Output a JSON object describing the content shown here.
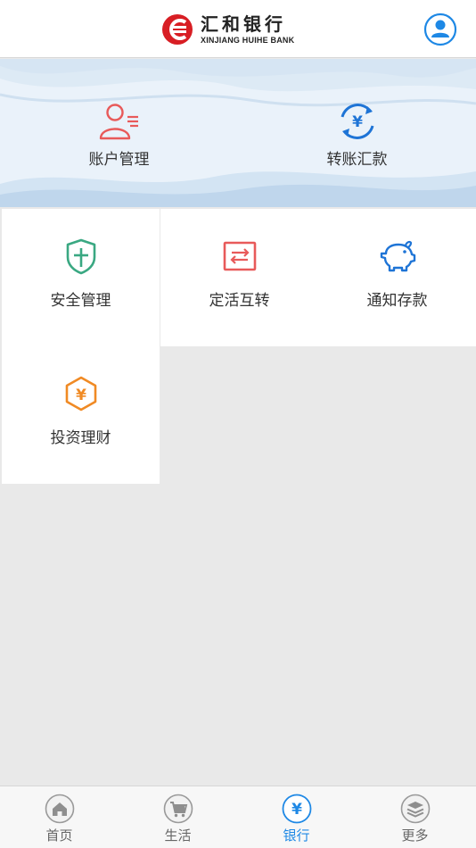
{
  "header": {
    "logo_cn": "汇和银行",
    "logo_en": "XINJIANG HUIHE BANK",
    "logo_icon": "bank-logo-icon",
    "user_icon": "user-avatar-icon"
  },
  "banner": {
    "items": [
      {
        "label": "账户管理",
        "icon": "account-user-icon",
        "color": "#e85a5a"
      },
      {
        "label": "转账汇款",
        "icon": "transfer-yuan-icon",
        "color": "#1e74d6"
      }
    ]
  },
  "grid": {
    "items": [
      {
        "label": "安全管理",
        "icon": "shield-icon",
        "color": "#3aa882"
      },
      {
        "label": "定活互转",
        "icon": "swap-arrows-icon",
        "color": "#e85a5a"
      },
      {
        "label": "通知存款",
        "icon": "piggy-bank-icon",
        "color": "#1e74d6"
      },
      {
        "label": "投资理财",
        "icon": "hexagon-yuan-icon",
        "color": "#f08a24"
      }
    ]
  },
  "tabbar": {
    "items": [
      {
        "label": "首页",
        "icon": "home-icon",
        "active": false
      },
      {
        "label": "生活",
        "icon": "cart-icon",
        "active": false
      },
      {
        "label": "银行",
        "icon": "yuan-icon",
        "active": true
      },
      {
        "label": "更多",
        "icon": "layers-icon",
        "active": false
      }
    ]
  },
  "colors": {
    "accent": "#1e88e5",
    "brand_red": "#d81e24",
    "background": "#e9e9e9",
    "banner_bg": "#eaf2fa"
  }
}
